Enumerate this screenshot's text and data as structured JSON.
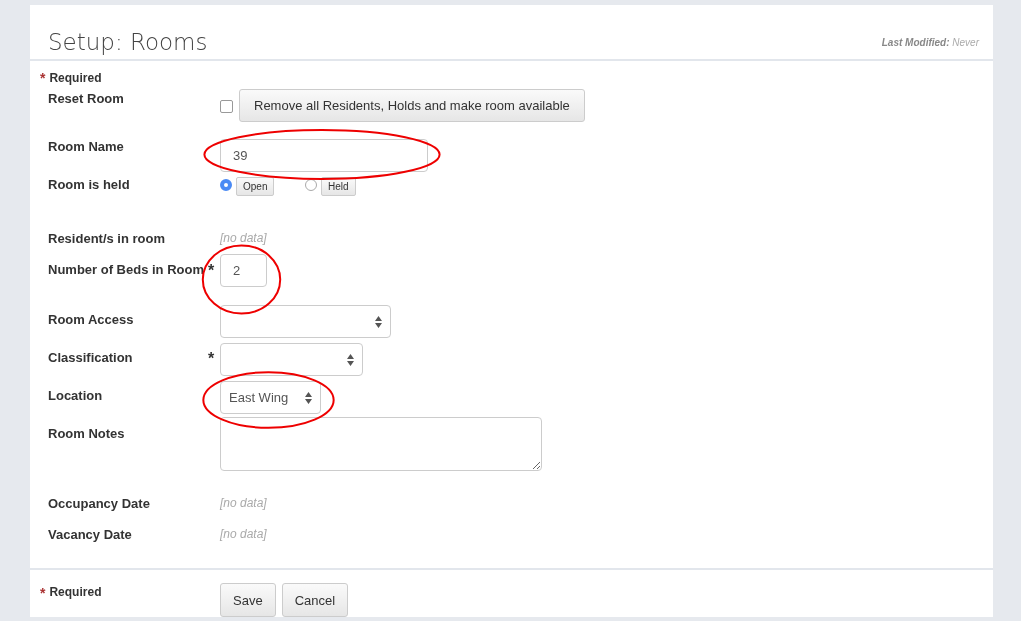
{
  "title": "Setup: Rooms",
  "last_modified": {
    "label": "Last Modified:",
    "value": "Never"
  },
  "required_note": {
    "mark": "*",
    "text": "Required"
  },
  "fields": [
    {
      "kind": "reset",
      "label": "Reset Room",
      "checked": false,
      "button": "Remove all Residents, Holds and make room available"
    },
    {
      "kind": "text",
      "label": "Room Name",
      "value": "39",
      "highlighted": true
    },
    {
      "kind": "radio",
      "label": "Room is held",
      "options": [
        {
          "label": "Open",
          "selected": true
        },
        {
          "label": "Held",
          "selected": false
        }
      ]
    },
    {
      "kind": "nodata",
      "label": "Resident/s in room",
      "value": "[no data]"
    },
    {
      "kind": "number",
      "label": "Number of Beds in Room",
      "required": "*",
      "value": "2",
      "highlighted": true
    },
    {
      "kind": "select",
      "label": "Room Access"
    },
    {
      "kind": "select",
      "label": "Classification",
      "required": "*"
    },
    {
      "kind": "select",
      "label": "Location",
      "value": "East Wing",
      "highlighted": true
    },
    {
      "kind": "textarea",
      "label": "Room Notes"
    },
    {
      "kind": "nodata",
      "label": "Occupancy Date",
      "value": "[no data]"
    },
    {
      "kind": "nodata",
      "label": "Vacancy Date",
      "value": "[no data]"
    }
  ],
  "footer": {
    "mark": "*",
    "text": "Required",
    "buttons": [
      "Save",
      "Cancel"
    ]
  }
}
